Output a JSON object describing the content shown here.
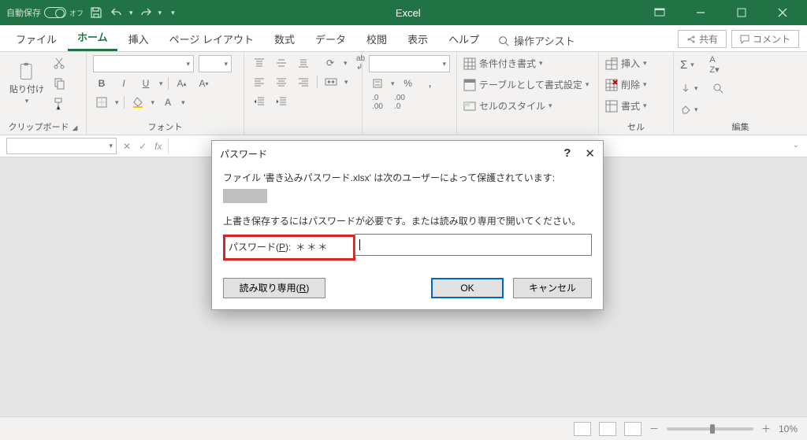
{
  "titlebar": {
    "autosave_label": "自動保存",
    "autosave_state": "オフ",
    "app_title": "Excel"
  },
  "tabs": {
    "file": "ファイル",
    "home": "ホーム",
    "insert": "挿入",
    "pagelayout": "ページ レイアウト",
    "formulas": "数式",
    "data": "データ",
    "review": "校閲",
    "view": "表示",
    "help": "ヘルプ",
    "tell_me": "操作アシスト",
    "share": "共有",
    "comments": "コメント"
  },
  "ribbon": {
    "clipboard": {
      "paste": "貼り付け",
      "label": "クリップボード"
    },
    "font": {
      "label": "フォント",
      "bold": "B",
      "italic": "I",
      "underline": "U"
    },
    "number": {
      "percent": "%"
    },
    "styles": {
      "conditional": "条件付き書式",
      "format_table": "テーブルとして書式設定",
      "cell_styles": "セルのスタイル"
    },
    "cells": {
      "insert": "挿入",
      "delete": "削除",
      "format": "書式",
      "label": "セル"
    },
    "editing": {
      "label": "編集"
    }
  },
  "dialog": {
    "title": "パスワード",
    "line1_pre": "ファイル '",
    "filename": "書き込みパスワード.xlsx",
    "line1_post": "' は次のユーザーによって保護されています:",
    "line2": "上書き保存するにはパスワードが必要です。または読み取り専用で開いてください。",
    "pw_label": "パスワード(",
    "pw_key": "P",
    "pw_label_post": "):",
    "pw_value": "＊＊＊",
    "readonly_pre": "読み取り専用(",
    "readonly_key": "R",
    "readonly_post": ")",
    "ok": "OK",
    "cancel": "キャンセル"
  },
  "status": {
    "zoom": "10%"
  },
  "icons": {
    "sigma": "Σ"
  }
}
